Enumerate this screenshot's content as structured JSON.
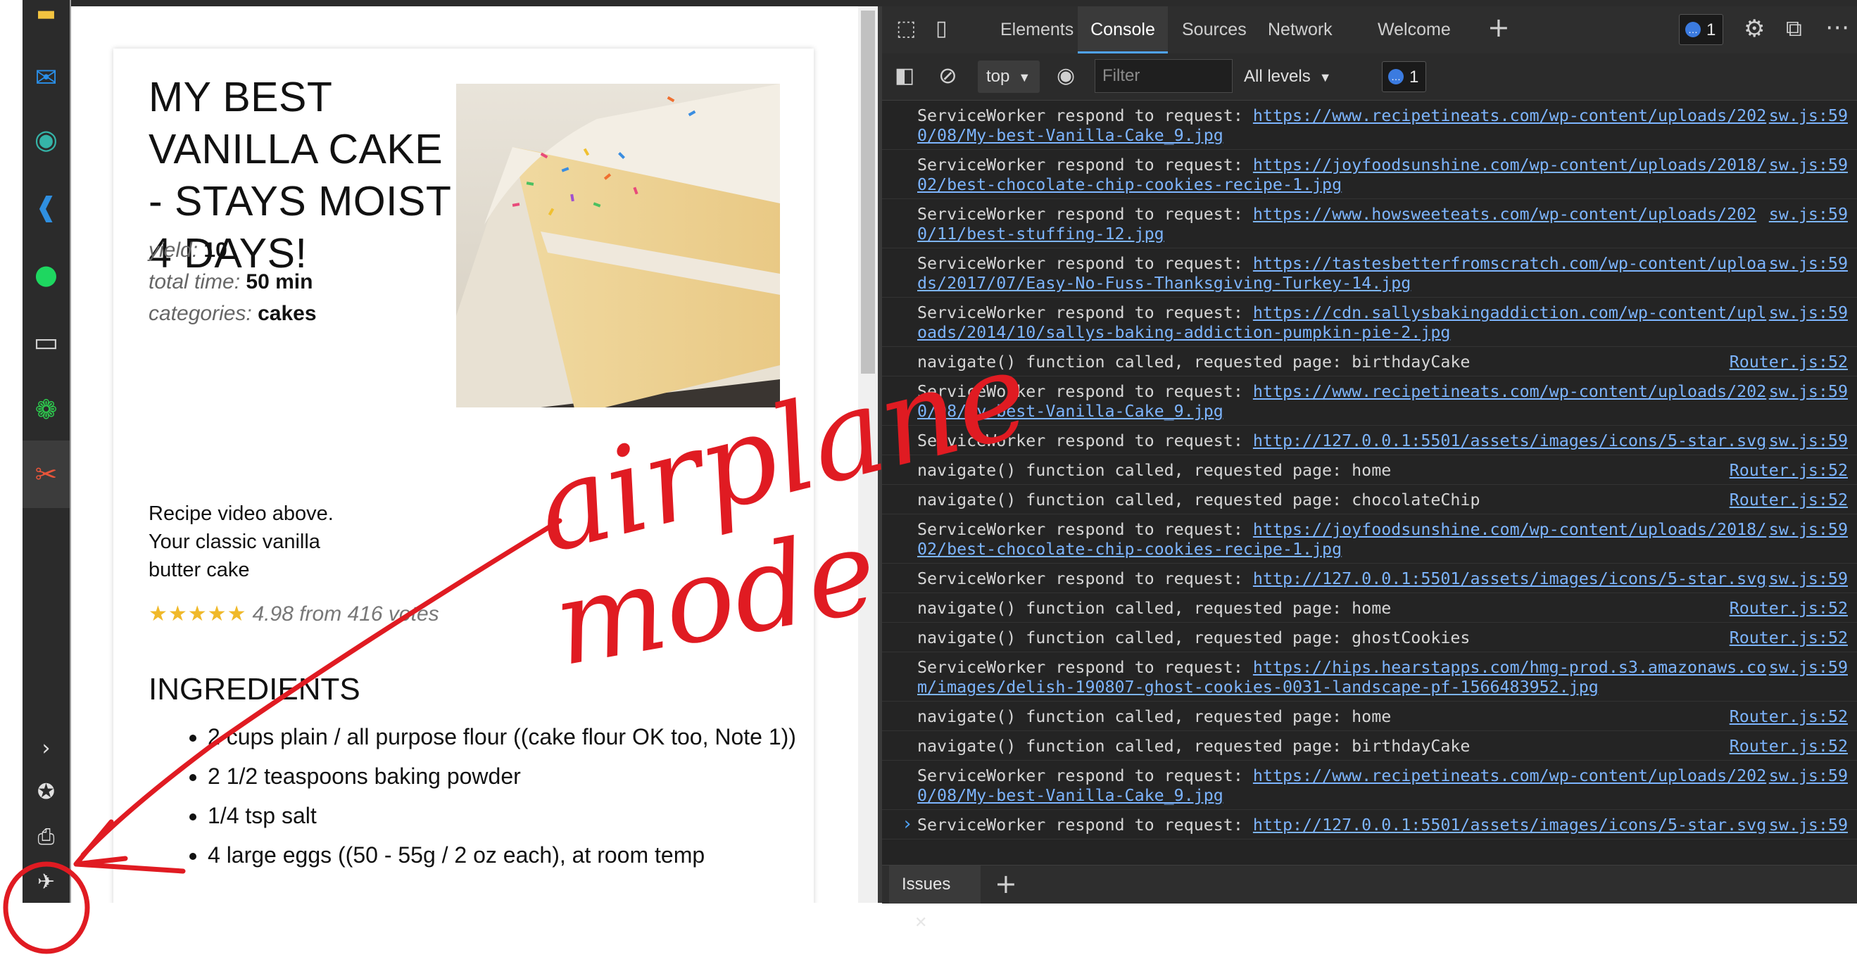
{
  "taskbar": {
    "icons": [
      "file-explorer-icon",
      "mail-icon",
      "edge-icon",
      "vscode-icon",
      "spotify-icon",
      "terminal-icon",
      "wechat-icon",
      "snip-icon"
    ],
    "bottom_icons": [
      "chevron-right-icon",
      "badge-icon",
      "printer-icon",
      "airplane-mode-icon"
    ]
  },
  "recipe": {
    "title": "MY BEST VANILLA CAKE - STAYS MOIST 4 DAYS!",
    "yield_label": "yield:",
    "yield_value": "10",
    "time_label": "total time:",
    "time_value": "50 min",
    "categories_label": "categories:",
    "categories_value": "cakes",
    "description": "Recipe video above. Your classic vanilla butter cake",
    "stars": "★★★★★",
    "rating_text": "4.98 from 416 votes",
    "ingredients_heading": "INGREDIENTS",
    "ingredients": [
      "2 cups plain / all purpose flour ((cake flour OK too, Note 1))",
      "2 1/2 teaspoons baking powder",
      "1/4 tsp salt",
      "4 large eggs ((50 - 55g / 2 oz each), at room temp"
    ]
  },
  "devtools": {
    "tabs": [
      "Elements",
      "Console",
      "Sources",
      "Network",
      "Welcome"
    ],
    "active_tab": "Console",
    "message_badge": "1",
    "context": "top",
    "filter_placeholder": "Filter",
    "levels": "All levels",
    "issues_badge": "1",
    "drawer_tab": "Issues",
    "prompt": "›",
    "log": [
      {
        "msg": "ServiceWorker respond to request:",
        "url": "https://www.recipetineats.com/wp-content/uploads/2020/08/My-best-Vanilla-Cake_9.jpg",
        "src": "sw.js:59"
      },
      {
        "msg": "ServiceWorker respond to request:",
        "url": "https://joyfoodsunshine.com/wp-content/uploads/2018/02/best-chocolate-chip-cookies-recipe-1.jpg",
        "src": "sw.js:59"
      },
      {
        "msg": "ServiceWorker respond to request:",
        "url": "https://www.howsweeteats.com/wp-content/uploads/2020/11/best-stuffing-12.jpg",
        "src": "sw.js:59"
      },
      {
        "msg": "ServiceWorker respond to request:",
        "url": "https://tastesbetterfromscratch.com/wp-content/uploads/2017/07/Easy-No-Fuss-Thanksgiving-Turkey-14.jpg",
        "src": "sw.js:59"
      },
      {
        "msg": "ServiceWorker respond to request:",
        "url": "https://cdn.sallysbakingaddiction.com/wp-content/uploads/2014/10/sallys-baking-addiction-pumpkin-pie-2.jpg",
        "src": "sw.js:59"
      },
      {
        "msg": "navigate() function called, requested page: birthdayCake",
        "url": "",
        "src": "Router.js:52"
      },
      {
        "msg": "ServiceWorker respond to request:",
        "url": "https://www.recipetineats.com/wp-content/uploads/2020/08/My-best-Vanilla-Cake_9.jpg",
        "src": "sw.js:59"
      },
      {
        "msg": "ServiceWorker respond to request:",
        "url": "http://127.0.0.1:5501/assets/images/icons/5-star.svg",
        "src": "sw.js:59"
      },
      {
        "msg": "navigate() function called, requested page: home",
        "url": "",
        "src": "Router.js:52"
      },
      {
        "msg": "navigate() function called, requested page: chocolateChip",
        "url": "",
        "src": "Router.js:52"
      },
      {
        "msg": "ServiceWorker respond to request:",
        "url": "https://joyfoodsunshine.com/wp-content/uploads/2018/02/best-chocolate-chip-cookies-recipe-1.jpg",
        "src": "sw.js:59"
      },
      {
        "msg": "ServiceWorker respond to request:",
        "url": "http://127.0.0.1:5501/assets/images/icons/5-star.svg",
        "src": "sw.js:59"
      },
      {
        "msg": "navigate() function called, requested page: home",
        "url": "",
        "src": "Router.js:52"
      },
      {
        "msg": "navigate() function called, requested page: ghostCookies",
        "url": "",
        "src": "Router.js:52"
      },
      {
        "msg": "ServiceWorker respond to request:",
        "url": "https://hips.hearstapps.com/hmg-prod.s3.amazonaws.com/images/delish-190807-ghost-cookies-0031-landscape-pf-1566483952.jpg",
        "src": "sw.js:59"
      },
      {
        "msg": "navigate() function called, requested page: home",
        "url": "",
        "src": "Router.js:52"
      },
      {
        "msg": "navigate() function called, requested page: birthdayCake",
        "url": "",
        "src": "Router.js:52"
      },
      {
        "msg": "ServiceWorker respond to request:",
        "url": "https://www.recipetineats.com/wp-content/uploads/2020/08/My-best-Vanilla-Cake_9.jpg",
        "src": "sw.js:59"
      },
      {
        "msg": "ServiceWorker respond to request:",
        "url": "http://127.0.0.1:5501/assets/images/icons/5-star.svg",
        "src": "sw.js:59"
      }
    ]
  },
  "annotation": {
    "line1": "airplane",
    "line2": "mode",
    "color": "#e01b22"
  },
  "colors": {
    "link": "#7db5ff",
    "devtools_bg": "#242424",
    "star": "#f0b92a",
    "accent": "#4fa3f7"
  }
}
